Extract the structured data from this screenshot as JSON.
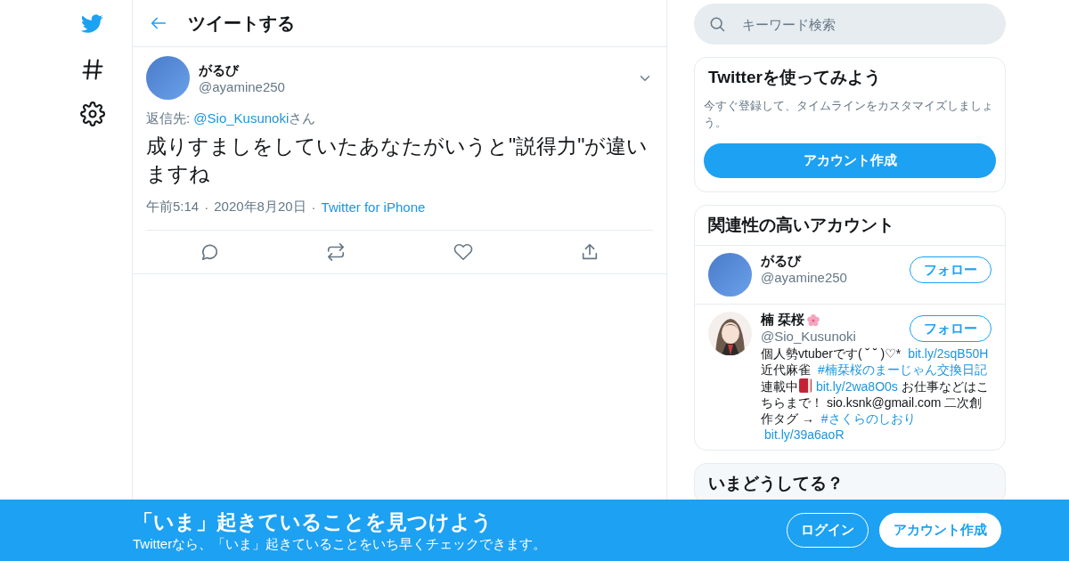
{
  "header": {
    "title": "ツイートする"
  },
  "tweet": {
    "name": "がるび",
    "handle": "@ayamine250",
    "reply_prefix": "返信先: ",
    "reply_to": "@Sio_Kusunoki",
    "reply_suffix": "さん",
    "text": "成りすましをしていたあなたがいうと\"説得力\"が違いますね",
    "time": "午前5:14",
    "separator": "·",
    "date": "2020年8月20日",
    "source": "Twitter for iPhone"
  },
  "search": {
    "placeholder": "キーワード検索"
  },
  "signup_card": {
    "title": "Twitterを使ってみよう",
    "text": "今すぐ登録して、タイムラインをカスタマイズしましょう。",
    "button": "アカウント作成"
  },
  "related": {
    "title": "関連性の高いアカウント",
    "accounts": [
      {
        "kind": "plain",
        "name": "がるび",
        "handle": "@ayamine250",
        "button": "フォロー"
      },
      {
        "kind": "picture",
        "name": "楠 栞桜",
        "handle": "@Sio_Kusunoki",
        "button": "フォロー",
        "bio": [
          {
            "kind": "text",
            "text": "個人勢vtuberです( ˘ ˘ )♡* "
          },
          {
            "kind": "link",
            "text": "bit.ly/2sqB50H"
          },
          {
            "kind": "text",
            "text": " 近代麻雀 "
          },
          {
            "kind": "link",
            "text": "#楠栞桜のまーじゃん交換日記"
          },
          {
            "kind": "text",
            "text": " 連載中"
          },
          {
            "kind": "book"
          },
          {
            "kind": "link",
            "text": "bit.ly/2wa8O0s"
          },
          {
            "kind": "text",
            "text": " お仕事などはこちらまで！ sio.ksnk@gmail.com 二次創作タグ → "
          },
          {
            "kind": "link",
            "text": "#さくらのしおり"
          },
          {
            "kind": "link",
            "text": "bit.ly/39a6aoR"
          }
        ]
      }
    ]
  },
  "trends": {
    "title": "いまどうしてる？"
  },
  "banner": {
    "title": "「いま」起きていることを見つけよう",
    "subtitle": "Twitterなら、「いま」起きていることをいち早くチェックできます。",
    "login": "ログイン",
    "signup": "アカウント作成"
  }
}
